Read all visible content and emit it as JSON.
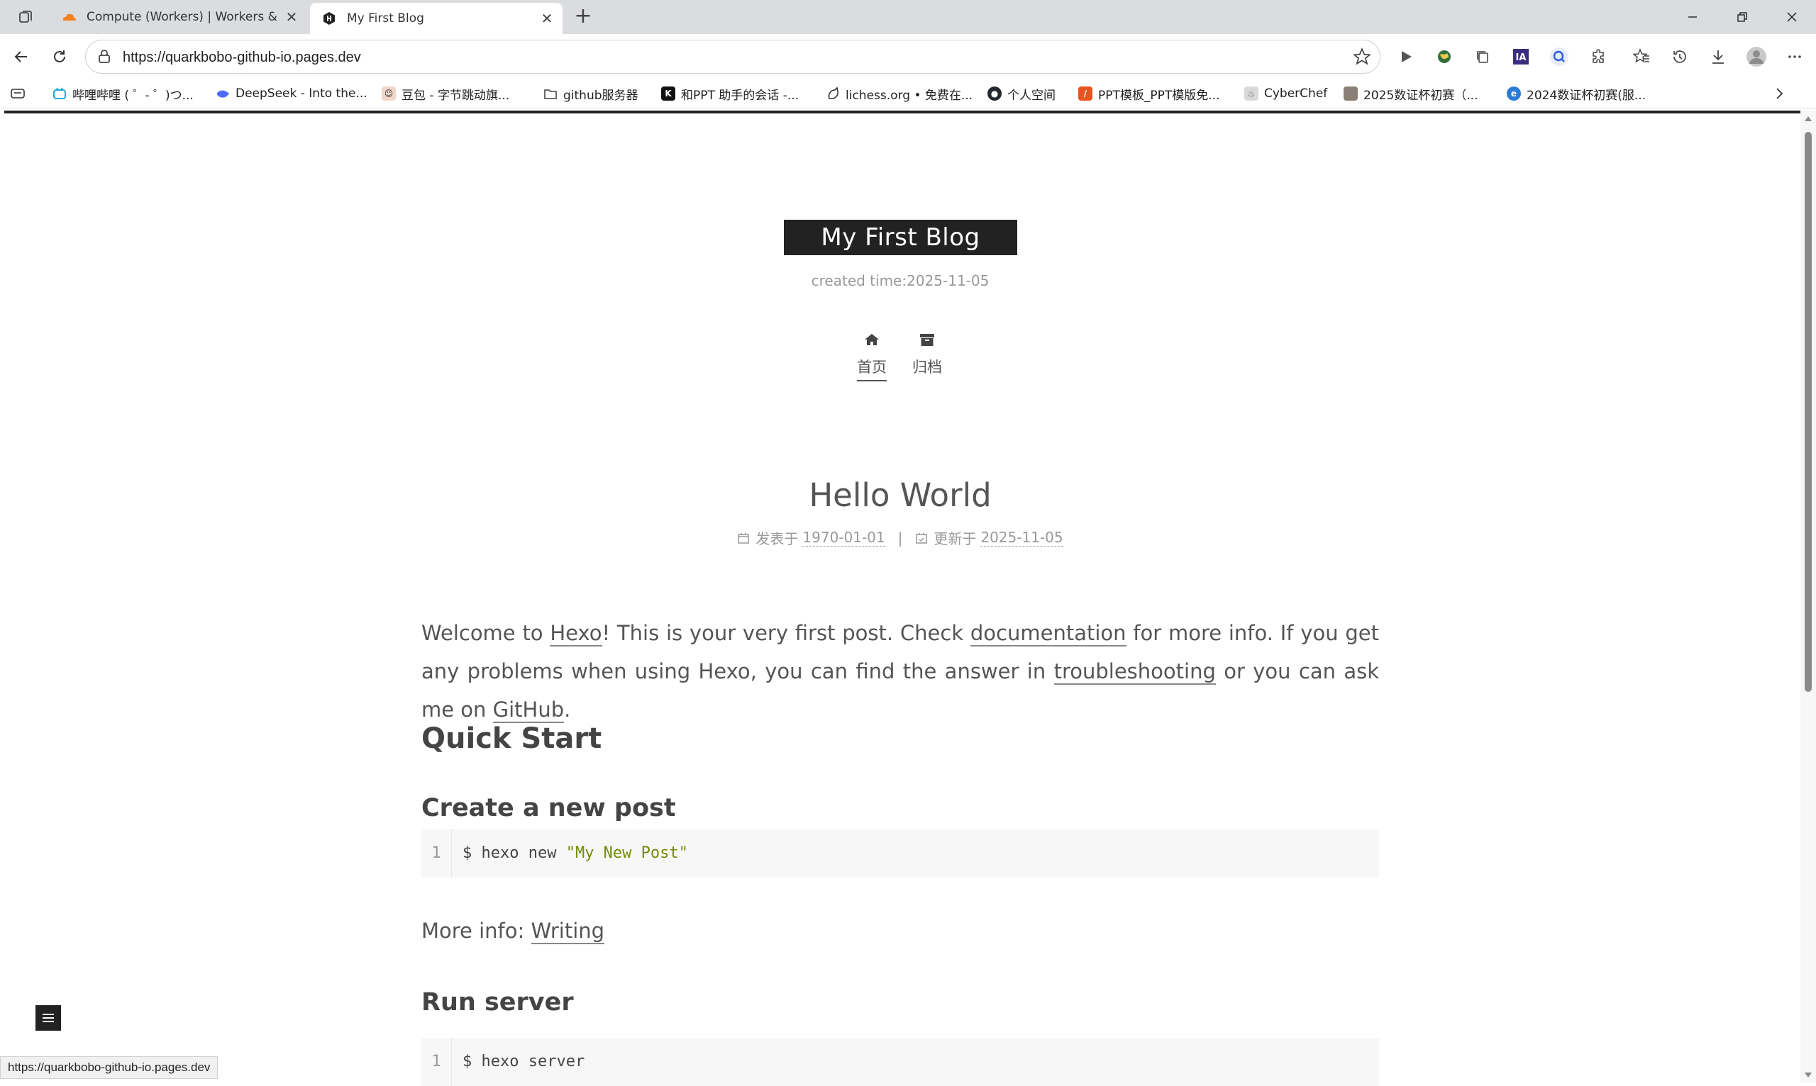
{
  "browser": {
    "tabs": [
      {
        "title": "Compute (Workers) | Workers & P",
        "icon": "cloudflare-icon",
        "active": false
      },
      {
        "title": "My First Blog",
        "icon": "hexo-icon",
        "active": true
      }
    ],
    "address_url": "https://quarkbobo-github-io.pages.dev",
    "status_url": "https://quarkbobo-github-io.pages.dev",
    "bookmarks": [
      {
        "label": "哔哩哔哩 ( ゜- ゜)つ...",
        "icon": "bilibili-icon",
        "color": "#00a1d6"
      },
      {
        "label": "DeepSeek - Into the...",
        "icon": "deepseek-icon",
        "color": "#4d6bfe"
      },
      {
        "label": "豆包 - 字节跳动旗...",
        "icon": "doubao-icon",
        "color": "#6b6b6b"
      },
      {
        "label": "github服务器",
        "icon": "folder-icon",
        "color": "#444444"
      },
      {
        "label": "和PPT 助手的会话 -...",
        "icon": "kimi-icon",
        "color": "#111111"
      },
      {
        "label": "lichess.org • 免费在...",
        "icon": "lichess-icon",
        "color": "#333333"
      },
      {
        "label": "个人空间",
        "icon": "github-icon",
        "color": "#24292e"
      },
      {
        "label": "PPT模板_PPT模版免...",
        "icon": "ppt-icon",
        "color": "#e8541e"
      },
      {
        "label": "CyberChef",
        "icon": "cyberchef-icon",
        "color": "#9a9a9a"
      },
      {
        "label": "2025数证杯初赛（...",
        "icon": "avatar-icon",
        "color": "#8a7f74"
      },
      {
        "label": "2024数证杯初赛(服...",
        "icon": "edge-icon",
        "color": "#2b7bd6"
      }
    ]
  },
  "blog": {
    "site_title": "My First Blog",
    "subtitle": "created time:2025-11-05",
    "menu": [
      {
        "label": "首页",
        "icon": "home-icon",
        "active": true
      },
      {
        "label": "归档",
        "icon": "archive-icon",
        "active": false
      }
    ],
    "post": {
      "title": "Hello World",
      "posted_label": "发表于",
      "posted_date": "1970-01-01",
      "separator": "|",
      "updated_label": "更新于",
      "updated_date": "2025-11-05",
      "intro_1": "Welcome to ",
      "link_hexo": "Hexo",
      "intro_2": "! This is your very first post. Check ",
      "link_docs": "documentation",
      "intro_3": " for more info. If you get any problems when using Hexo, you can find the answer in ",
      "link_troubleshooting": "troubleshooting",
      "intro_4": " or you can ask me on ",
      "link_github": "GitHub",
      "intro_5": ".",
      "h2_quick_start": "Quick Start",
      "h3_create_post": "Create a new post",
      "code1_line": "1",
      "code1_cmd": "$ hexo new ",
      "code1_str": "\"My New Post\"",
      "more_info_label": "More info: ",
      "more_info_link": "Writing",
      "h3_run_server": "Run server",
      "code2_line": "1",
      "code2_cmd": "$ hexo server"
    }
  }
}
